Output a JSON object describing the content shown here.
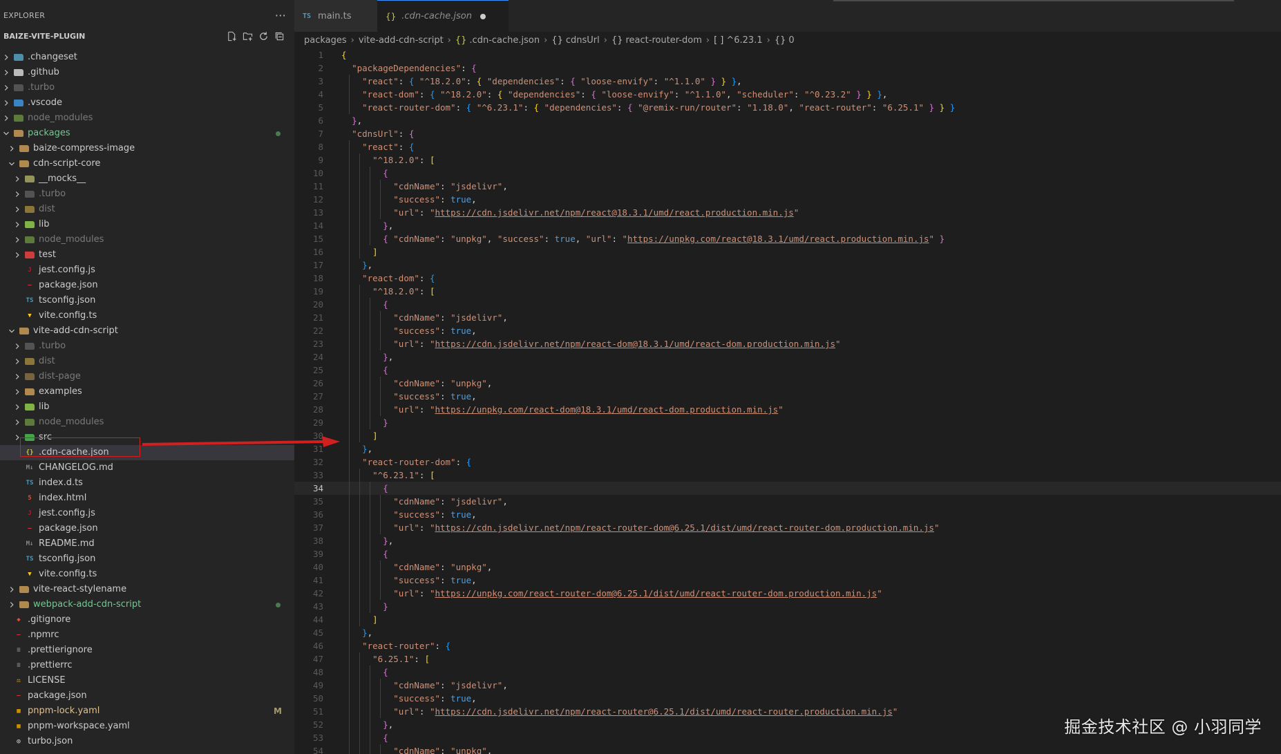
{
  "sidebar": {
    "title": "EXPLORER",
    "more_label": "···",
    "section_title": "BAIZE-VITE-PLUGIN",
    "actions": [
      {
        "name": "new-file-icon"
      },
      {
        "name": "new-folder-icon"
      },
      {
        "name": "refresh-icon"
      },
      {
        "name": "collapse-all-icon"
      }
    ],
    "tree": [
      {
        "label": ".changeset",
        "depth": 0,
        "type": "folder",
        "open": false,
        "icon": "changeset-folder-icon",
        "color": "#519aba"
      },
      {
        "label": ".github",
        "depth": 0,
        "type": "folder",
        "open": false,
        "icon": "github-folder-icon",
        "color": "#cccccc"
      },
      {
        "label": ".turbo",
        "depth": 0,
        "type": "folder",
        "open": false,
        "icon": "turbo-folder-icon",
        "color": "#7a7a7a",
        "dim": true
      },
      {
        "label": ".vscode",
        "depth": 0,
        "type": "folder",
        "open": false,
        "icon": "vscode-folder-icon",
        "color": "#3c8fd6"
      },
      {
        "label": "node_modules",
        "depth": 0,
        "type": "folder",
        "open": false,
        "icon": "node-folder-icon",
        "color": "#8bc34a",
        "dim": true
      },
      {
        "label": "packages",
        "depth": 0,
        "type": "folder",
        "open": true,
        "icon": "packages-folder-icon",
        "color": "#c09553",
        "untracked": true,
        "dot": true
      },
      {
        "label": "baize-compress-image",
        "depth": 1,
        "type": "folder",
        "open": false,
        "icon": "folder-icon",
        "color": "#c09553"
      },
      {
        "label": "cdn-script-core",
        "depth": 1,
        "type": "folder",
        "open": true,
        "icon": "folder-icon",
        "color": "#c09553"
      },
      {
        "label": "__mocks__",
        "depth": 2,
        "type": "folder",
        "open": false,
        "icon": "mocks-folder-icon",
        "color": "#a0a060"
      },
      {
        "label": ".turbo",
        "depth": 2,
        "type": "folder",
        "open": false,
        "icon": "turbo-folder-icon",
        "color": "#7a7a7a",
        "dim": true
      },
      {
        "label": "dist",
        "depth": 2,
        "type": "folder",
        "open": false,
        "icon": "dist-folder-icon",
        "color": "#e0b94a",
        "dim": true
      },
      {
        "label": "lib",
        "depth": 2,
        "type": "folder",
        "open": false,
        "icon": "lib-folder-icon",
        "color": "#8bc34a"
      },
      {
        "label": "node_modules",
        "depth": 2,
        "type": "folder",
        "open": false,
        "icon": "node-folder-icon",
        "color": "#8bc34a",
        "dim": true
      },
      {
        "label": "test",
        "depth": 2,
        "type": "folder",
        "open": false,
        "icon": "test-folder-icon",
        "color": "#e04040"
      },
      {
        "label": "jest.config.js",
        "depth": 2,
        "type": "file",
        "icon": "jest-icon",
        "color": "#c21325"
      },
      {
        "label": "package.json",
        "depth": 2,
        "type": "file",
        "icon": "npm-icon",
        "color": "#cb3837"
      },
      {
        "label": "tsconfig.json",
        "depth": 2,
        "type": "file",
        "icon": "tsconfig-icon",
        "color": "#519aba"
      },
      {
        "label": "vite.config.ts",
        "depth": 2,
        "type": "file",
        "icon": "vite-icon",
        "color": "#ffc517"
      },
      {
        "label": "vite-add-cdn-script",
        "depth": 1,
        "type": "folder",
        "open": true,
        "icon": "folder-icon",
        "color": "#c09553"
      },
      {
        "label": ".turbo",
        "depth": 2,
        "type": "folder",
        "open": false,
        "icon": "turbo-folder-icon",
        "color": "#7a7a7a",
        "dim": true
      },
      {
        "label": "dist",
        "depth": 2,
        "type": "folder",
        "open": false,
        "icon": "dist-folder-icon",
        "color": "#e0b94a",
        "dim": true
      },
      {
        "label": "dist-page",
        "depth": 2,
        "type": "folder",
        "open": false,
        "icon": "folder-icon",
        "color": "#c09553",
        "dim": true
      },
      {
        "label": "examples",
        "depth": 2,
        "type": "folder",
        "open": false,
        "icon": "folder-icon",
        "color": "#c09553"
      },
      {
        "label": "lib",
        "depth": 2,
        "type": "folder",
        "open": false,
        "icon": "lib-folder-icon",
        "color": "#8bc34a"
      },
      {
        "label": "node_modules",
        "depth": 2,
        "type": "folder",
        "open": false,
        "icon": "node-folder-icon",
        "color": "#8bc34a",
        "dim": true
      },
      {
        "label": "src",
        "depth": 2,
        "type": "folder",
        "open": false,
        "icon": "src-folder-icon",
        "color": "#4caf50"
      },
      {
        "label": ".cdn-cache.json",
        "depth": 2,
        "type": "file",
        "icon": "json-icon",
        "color": "#cbcb41",
        "selected": true
      },
      {
        "label": "CHANGELOG.md",
        "depth": 2,
        "type": "file",
        "icon": "markdown-icon",
        "color": "#888888"
      },
      {
        "label": "index.d.ts",
        "depth": 2,
        "type": "file",
        "icon": "typescript-def-icon",
        "color": "#519aba"
      },
      {
        "label": "index.html",
        "depth": 2,
        "type": "file",
        "icon": "html-icon",
        "color": "#e34c26"
      },
      {
        "label": "jest.config.js",
        "depth": 2,
        "type": "file",
        "icon": "jest-icon",
        "color": "#c21325"
      },
      {
        "label": "package.json",
        "depth": 2,
        "type": "file",
        "icon": "npm-icon",
        "color": "#cb3837"
      },
      {
        "label": "README.md",
        "depth": 2,
        "type": "file",
        "icon": "markdown-icon",
        "color": "#888888"
      },
      {
        "label": "tsconfig.json",
        "depth": 2,
        "type": "file",
        "icon": "tsconfig-icon",
        "color": "#519aba"
      },
      {
        "label": "vite.config.ts",
        "depth": 2,
        "type": "file",
        "icon": "vite-icon",
        "color": "#ffc517"
      },
      {
        "label": "vite-react-stylename",
        "depth": 1,
        "type": "folder",
        "open": false,
        "icon": "folder-icon",
        "color": "#c09553"
      },
      {
        "label": "webpack-add-cdn-script",
        "depth": 1,
        "type": "folder",
        "open": false,
        "icon": "folder-icon",
        "color": "#c09553",
        "untracked": true,
        "dot": true
      },
      {
        "label": ".gitignore",
        "depth": 0,
        "type": "file",
        "icon": "git-icon",
        "color": "#e04e39"
      },
      {
        "label": ".npmrc",
        "depth": 0,
        "type": "file",
        "icon": "npm-icon",
        "color": "#cb3837"
      },
      {
        "label": ".prettierignore",
        "depth": 0,
        "type": "file",
        "icon": "prettier-icon",
        "color": "#888888"
      },
      {
        "label": ".prettierrc",
        "depth": 0,
        "type": "file",
        "icon": "prettier-icon",
        "color": "#888888"
      },
      {
        "label": "LICENSE",
        "depth": 0,
        "type": "file",
        "icon": "license-icon",
        "color": "#d4a017"
      },
      {
        "label": "package.json",
        "depth": 0,
        "type": "file",
        "icon": "npm-icon",
        "color": "#cb3837"
      },
      {
        "label": "pnpm-lock.yaml",
        "depth": 0,
        "type": "file",
        "icon": "pnpm-icon",
        "color": "#f9ad00",
        "modified": true,
        "badge": "M"
      },
      {
        "label": "pnpm-workspace.yaml",
        "depth": 0,
        "type": "file",
        "icon": "pnpm-icon",
        "color": "#f9ad00"
      },
      {
        "label": "turbo.json",
        "depth": 0,
        "type": "file",
        "icon": "turbo-icon",
        "color": "#e0e0e0"
      }
    ]
  },
  "tabs": [
    {
      "label": "main.ts",
      "icon": "TS",
      "active": false
    },
    {
      "label": ".cdn-cache.json",
      "icon": "{}",
      "active": true,
      "dirty": true
    }
  ],
  "breadcrumb": [
    {
      "label": "packages"
    },
    {
      "label": "vite-add-cdn-script"
    },
    {
      "label": ".cdn-cache.json",
      "icon": "{}"
    },
    {
      "label": "cdnsUrl",
      "icon": "{}"
    },
    {
      "label": "react-router-dom",
      "icon": "{}"
    },
    {
      "label": "^6.23.1",
      "icon": "[ ]"
    },
    {
      "label": "0",
      "icon": "{}"
    }
  ],
  "editor": {
    "current_line": 34,
    "lines": [
      "{",
      "  \"packageDependencies\": {",
      "    \"react\": { \"^18.2.0\": { \"dependencies\": { \"loose-envify\": \"^1.1.0\" } } },",
      "    \"react-dom\": { \"^18.2.0\": { \"dependencies\": { \"loose-envify\": \"^1.1.0\", \"scheduler\": \"^0.23.2\" } } },",
      "    \"react-router-dom\": { \"^6.23.1\": { \"dependencies\": { \"@remix-run/router\": \"1.18.0\", \"react-router\": \"6.25.1\" } } }",
      "  },",
      "  \"cdnsUrl\": {",
      "    \"react\": {",
      "      \"^18.2.0\": [",
      "        {",
      "          \"cdnName\": \"jsdelivr\",",
      "          \"success\": true,",
      "          \"url\": \"https://cdn.jsdelivr.net/npm/react@18.3.1/umd/react.production.min.js\"",
      "        },",
      "        { \"cdnName\": \"unpkg\", \"success\": true, \"url\": \"https://unpkg.com/react@18.3.1/umd/react.production.min.js\" }",
      "      ]",
      "    },",
      "    \"react-dom\": {",
      "      \"^18.2.0\": [",
      "        {",
      "          \"cdnName\": \"jsdelivr\",",
      "          \"success\": true,",
      "          \"url\": \"https://cdn.jsdelivr.net/npm/react-dom@18.3.1/umd/react-dom.production.min.js\"",
      "        },",
      "        {",
      "          \"cdnName\": \"unpkg\",",
      "          \"success\": true,",
      "          \"url\": \"https://unpkg.com/react-dom@18.3.1/umd/react-dom.production.min.js\"",
      "        }",
      "      ]",
      "    },",
      "    \"react-router-dom\": {",
      "      \"^6.23.1\": [",
      "        {",
      "          \"cdnName\": \"jsdelivr\",",
      "          \"success\": true,",
      "          \"url\": \"https://cdn.jsdelivr.net/npm/react-router-dom@6.25.1/dist/umd/react-router-dom.production.min.js\"",
      "        },",
      "        {",
      "          \"cdnName\": \"unpkg\",",
      "          \"success\": true,",
      "          \"url\": \"https://unpkg.com/react-router-dom@6.25.1/dist/umd/react-router-dom.production.min.js\"",
      "        }",
      "      ]",
      "    },",
      "    \"react-router\": {",
      "      \"6.25.1\": [",
      "        {",
      "          \"cdnName\": \"jsdelivr\",",
      "          \"success\": true,",
      "          \"url\": \"https://cdn.jsdelivr.net/npm/react-router@6.25.1/dist/umd/react-router.production.min.js\"",
      "        },",
      "        {",
      "          \"cdnName\": \"unpkg\","
    ]
  },
  "watermark": "掘金技术社区 @ 小羽同学",
  "colors": {
    "editor_bg": "#1e1e1e",
    "sidebar_bg": "#252526",
    "accent": "#3794ff",
    "annotation_red": "#d02020"
  }
}
